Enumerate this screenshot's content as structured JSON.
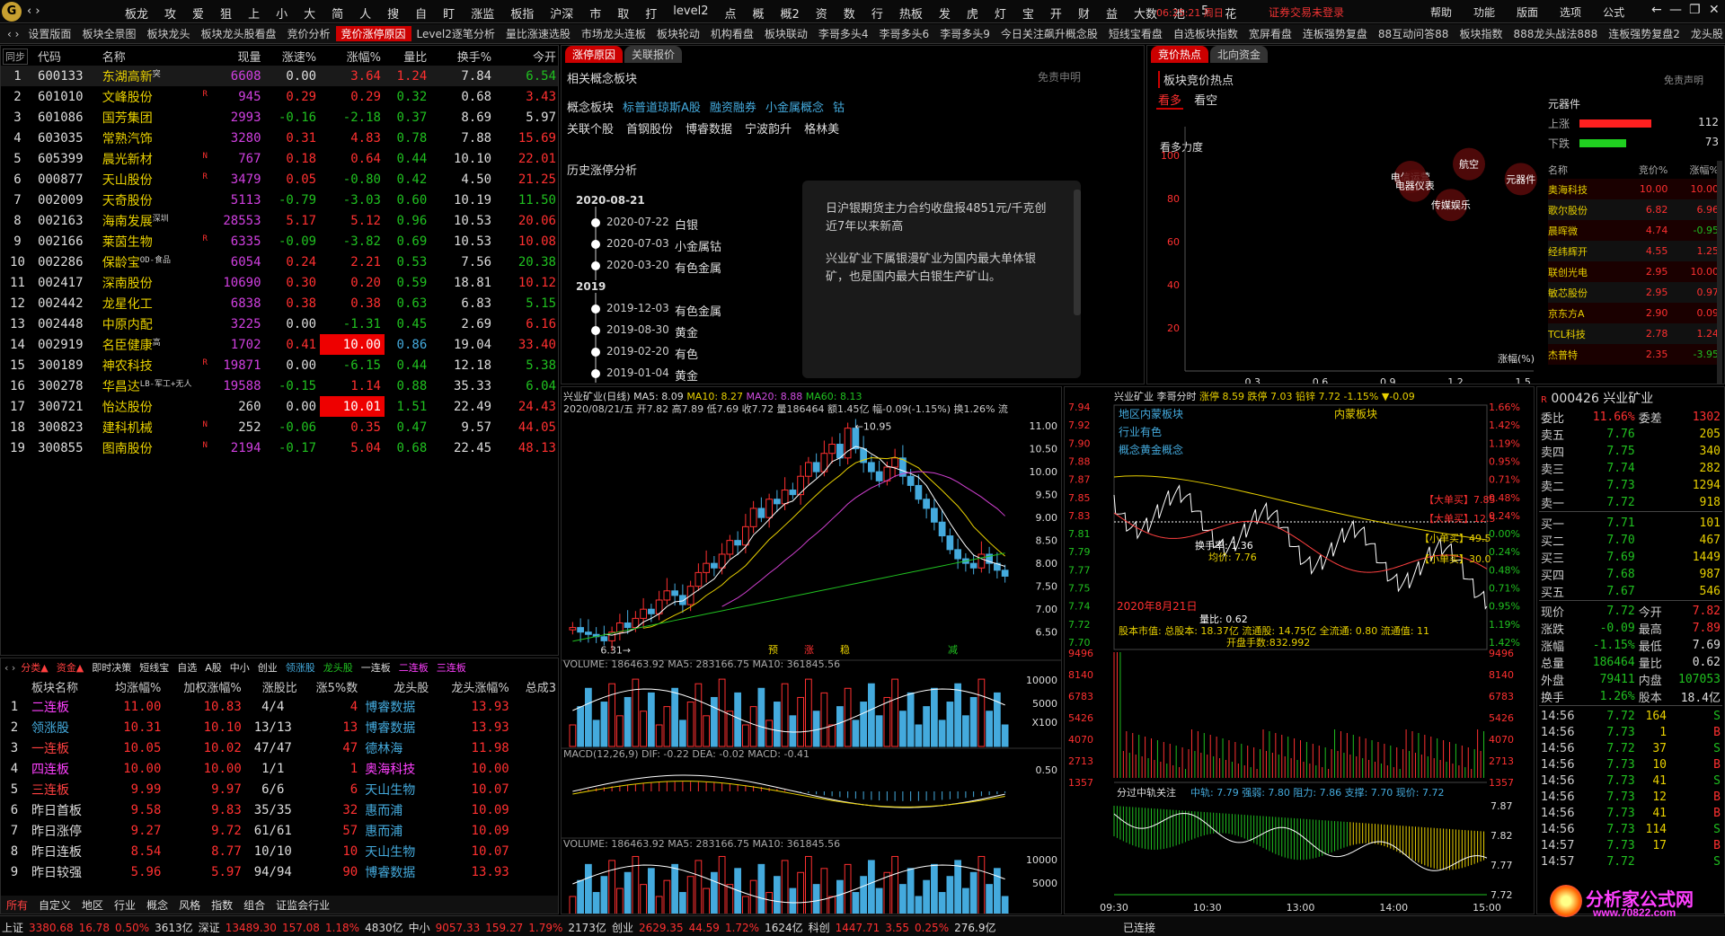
{
  "topbar": {
    "menu": [
      "板龙",
      "攻",
      "爱",
      "狙",
      "上",
      "小",
      "大",
      "简",
      "人",
      "搜",
      "自",
      "盯",
      "涨监",
      "板指",
      "沪深",
      "市",
      "取",
      "打",
      "level2",
      "点",
      "概",
      "概2",
      "资",
      "数",
      "行",
      "热板",
      "发",
      "虎",
      "灯",
      "宝",
      "开",
      "财",
      "益",
      "大数",
      "池",
      "5",
      "花"
    ],
    "clock": "06:25:21 周日",
    "status": "证券交易未登录",
    "right": [
      "帮助",
      "功能",
      "版面",
      "选项",
      "公式"
    ]
  },
  "tabs": [
    "设置版面",
    "板块全景图",
    "板块龙头",
    "板块龙头股看盘",
    "竞价分析",
    "竞价涨停原因",
    "Level2逐笔分析",
    "量比涨速选股",
    "市场龙头连板",
    "板块轮动",
    "机构看盘",
    "板块联动",
    "李哥多头4",
    "李哥多头6",
    "李哥多头9",
    "今日关注飙升概念股",
    "短线宝看盘",
    "自选板块指数",
    "宽屏看盘",
    "连板强势复盘",
    "88互动问答88",
    "板块指数",
    "888龙头战法888",
    "连板强势复盘2",
    "龙头股"
  ],
  "active_tab": "竞价涨停原因",
  "stock_list": {
    "headers": [
      "代码",
      "名称",
      "",
      "现量",
      "涨速%",
      "涨幅%",
      "量比",
      "换手%",
      "今开"
    ],
    "rows": [
      {
        "n": "1",
        "code": "600133",
        "name": "东湖高新",
        "tag": "突",
        "mark": "",
        "vol": "6608",
        "spd": "0.00",
        "chg": "3.64",
        "lb": "1.24",
        "hs": "7.84",
        "open": "6.54",
        "vc": "mag",
        "sc": "wht",
        "cc": "red",
        "oc": "grn",
        "lc": "red"
      },
      {
        "n": "2",
        "code": "601010",
        "name": "文峰股份",
        "tag": "",
        "mark": "R",
        "vol": "945",
        "spd": "0.29",
        "chg": "0.29",
        "lb": "0.32",
        "hs": "0.68",
        "open": "3.43",
        "vc": "mag",
        "sc": "red",
        "cc": "red",
        "oc": "red",
        "lc": "grn"
      },
      {
        "n": "3",
        "code": "601086",
        "name": "国芳集团",
        "tag": "",
        "mark": "",
        "vol": "2993",
        "spd": "-0.16",
        "chg": "-2.18",
        "lb": "0.37",
        "hs": "8.69",
        "open": "5.97",
        "vc": "mag",
        "sc": "grn",
        "cc": "grn",
        "oc": "wht",
        "lc": "grn"
      },
      {
        "n": "4",
        "code": "603035",
        "name": "常熟汽饰",
        "tag": "",
        "mark": "",
        "vol": "3280",
        "spd": "0.31",
        "chg": "4.83",
        "lb": "0.78",
        "hs": "7.88",
        "open": "15.69",
        "vc": "mag",
        "sc": "red",
        "cc": "red",
        "oc": "red",
        "lc": "grn"
      },
      {
        "n": "5",
        "code": "605399",
        "name": "晨光新材",
        "tag": "",
        "mark": "N",
        "vol": "767",
        "spd": "0.18",
        "chg": "0.64",
        "lb": "0.44",
        "hs": "10.10",
        "open": "22.01",
        "vc": "mag",
        "sc": "red",
        "cc": "red",
        "oc": "red",
        "lc": "grn"
      },
      {
        "n": "6",
        "code": "000877",
        "name": "天山股份",
        "tag": "",
        "mark": "R",
        "vol": "3479",
        "spd": "0.05",
        "chg": "-0.80",
        "lb": "0.42",
        "hs": "4.50",
        "open": "21.25",
        "vc": "mag",
        "sc": "red",
        "cc": "grn",
        "oc": "red",
        "lc": "grn"
      },
      {
        "n": "7",
        "code": "002009",
        "name": "天奇股份",
        "tag": "",
        "mark": "",
        "vol": "5113",
        "spd": "-0.79",
        "chg": "-3.03",
        "lb": "0.60",
        "hs": "10.19",
        "open": "11.50",
        "vc": "mag",
        "sc": "grn",
        "cc": "grn",
        "oc": "grn",
        "lc": "grn"
      },
      {
        "n": "8",
        "code": "002163",
        "name": "海南发展",
        "tag": "深圳",
        "mark": "",
        "vol": "28553",
        "spd": "5.17",
        "chg": "5.12",
        "lb": "0.96",
        "hs": "10.53",
        "open": "20.06",
        "vc": "mag",
        "sc": "red",
        "cc": "red",
        "oc": "red",
        "lc": "grn"
      },
      {
        "n": "9",
        "code": "002166",
        "name": "莱茵生物",
        "tag": "",
        "mark": "R",
        "vol": "6335",
        "spd": "-0.09",
        "chg": "-3.82",
        "lb": "0.69",
        "hs": "10.53",
        "open": "10.08",
        "vc": "mag",
        "sc": "grn",
        "cc": "grn",
        "oc": "red",
        "lc": "grn"
      },
      {
        "n": "10",
        "code": "002286",
        "name": "保龄宝",
        "tag": "OD-食品",
        "mark": "",
        "vol": "6054",
        "spd": "0.24",
        "chg": "2.21",
        "lb": "0.53",
        "hs": "7.56",
        "open": "20.38",
        "vc": "mag",
        "sc": "red",
        "cc": "red",
        "oc": "grn",
        "lc": "grn"
      },
      {
        "n": "11",
        "code": "002417",
        "name": "深南股份",
        "tag": "",
        "mark": "",
        "vol": "10690",
        "spd": "0.30",
        "chg": "0.20",
        "lb": "0.59",
        "hs": "18.81",
        "open": "10.12",
        "vc": "mag",
        "sc": "red",
        "cc": "red",
        "oc": "red",
        "lc": "grn"
      },
      {
        "n": "12",
        "code": "002442",
        "name": "龙星化工",
        "tag": "",
        "mark": "",
        "vol": "6838",
        "spd": "0.38",
        "chg": "0.38",
        "lb": "0.63",
        "hs": "6.83",
        "open": "5.15",
        "vc": "mag",
        "sc": "red",
        "cc": "red",
        "oc": "grn",
        "lc": "grn"
      },
      {
        "n": "13",
        "code": "002448",
        "name": "中原内配",
        "tag": "",
        "mark": "",
        "vol": "3225",
        "spd": "0.00",
        "chg": "-1.31",
        "lb": "0.45",
        "hs": "2.69",
        "open": "6.16",
        "vc": "mag",
        "sc": "wht",
        "cc": "grn",
        "oc": "red",
        "lc": "grn"
      },
      {
        "n": "14",
        "code": "002919",
        "name": "名臣健康",
        "tag": "高",
        "mark": "",
        "vol": "1702",
        "spd": "0.41",
        "chg": "10.00",
        "lb": "0.86",
        "hs": "19.04",
        "open": "33.40",
        "vc": "mag",
        "sc": "red",
        "cc": "hl",
        "oc": "red",
        "lc": "cyan"
      },
      {
        "n": "15",
        "code": "300189",
        "name": "神农科技",
        "tag": "",
        "mark": "R",
        "vol": "19871",
        "spd": "0.00",
        "chg": "-6.15",
        "lb": "0.44",
        "hs": "12.18",
        "open": "5.38",
        "vc": "mag",
        "sc": "wht",
        "cc": "grn",
        "oc": "grn",
        "lc": "grn"
      },
      {
        "n": "16",
        "code": "300278",
        "name": "华昌达",
        "tag": "LB-军工+无人",
        "mark": "",
        "vol": "19588",
        "spd": "-0.15",
        "chg": "1.14",
        "lb": "0.88",
        "hs": "35.33",
        "open": "6.04",
        "vc": "mag",
        "sc": "grn",
        "cc": "red",
        "oc": "grn",
        "lc": "grn"
      },
      {
        "n": "17",
        "code": "300721",
        "name": "怡达股份",
        "tag": "",
        "mark": "",
        "vol": "260",
        "spd": "0.00",
        "chg": "10.01",
        "lb": "1.51",
        "hs": "22.49",
        "open": "24.43",
        "vc": "wht",
        "sc": "wht",
        "cc": "hl",
        "oc": "red",
        "lc": "grn"
      },
      {
        "n": "18",
        "code": "300823",
        "name": "建科机械",
        "tag": "",
        "mark": "N",
        "vol": "252",
        "spd": "-0.06",
        "chg": "0.35",
        "lb": "0.47",
        "hs": "9.57",
        "open": "44.05",
        "vc": "wht",
        "sc": "grn",
        "cc": "red",
        "oc": "red",
        "lc": "grn"
      },
      {
        "n": "19",
        "code": "300855",
        "name": "图南股份",
        "tag": "",
        "mark": "N",
        "vol": "2194",
        "spd": "-0.17",
        "chg": "5.04",
        "lb": "0.68",
        "hs": "22.45",
        "open": "48.13",
        "vc": "mag",
        "sc": "grn",
        "cc": "red",
        "oc": "red",
        "lc": "grn"
      }
    ]
  },
  "concept": {
    "tabs": [
      "涨停原因",
      "关联报价"
    ],
    "title": "相关概念板块",
    "disclaimer": "免责申明",
    "label1": "概念板块",
    "items1": [
      "标普道琼斯A股",
      "融资融券",
      "小金属概念",
      "钴"
    ],
    "label2": "关联个股",
    "items2": [
      "首钢股份",
      "博睿数据",
      "宁波韵升",
      "格林美"
    ],
    "history_title": "历史涨停分析",
    "timeline": [
      {
        "year": "2020-08-21",
        "entries": [
          [
            "2020-07-22",
            "白银"
          ],
          [
            "2020-07-03",
            "小金属钴"
          ],
          [
            "2020-03-20",
            "有色金属"
          ]
        ]
      },
      {
        "year": "2019",
        "entries": [
          [
            "2019-12-03",
            "有色金属"
          ],
          [
            "2019-08-30",
            "黄金"
          ],
          [
            "2019-02-20",
            "有色"
          ],
          [
            "2019-01-04",
            "黄金"
          ]
        ]
      }
    ],
    "popup": [
      "日沪银期货主力合约收盘报4851元/千克创近7年以来新高",
      "兴业矿业下属银漫矿业为国内最大单体银矿，也是国内最大白银生产矿山。"
    ]
  },
  "hot": {
    "tabs": [
      "竞价热点",
      "北向资金"
    ],
    "title": "板块竞价热点",
    "disclaimer": "免责声明",
    "bull": "看多",
    "bear": "看空",
    "ylabel": "看多力度",
    "xlabel": "涨幅(%)",
    "yticks": [
      "100",
      "80",
      "60",
      "40",
      "20"
    ],
    "xticks": [
      "0.3",
      "0.6",
      "0.9",
      "1.2",
      "1.5"
    ],
    "bubbles": [
      {
        "label": "航空",
        "x": 1.26,
        "y": 96
      },
      {
        "label": "电信运营",
        "x": 1.0,
        "y": 90
      },
      {
        "label": "电器仪表",
        "x": 1.02,
        "y": 86
      },
      {
        "label": "元器件",
        "x": 1.49,
        "y": 89
      },
      {
        "label": "传媒娱乐",
        "x": 1.18,
        "y": 77
      }
    ]
  },
  "sector": {
    "name": "元器件",
    "up_label": "上涨",
    "up": "112",
    "down_label": "下跌",
    "down": "73",
    "headers": [
      "名称",
      "竞价%",
      "涨幅%"
    ],
    "rows": [
      [
        "奥海科技",
        "10.00",
        "10.00"
      ],
      [
        "歌尔股份",
        "6.82",
        "6.96"
      ],
      [
        "晨晖微",
        "4.74",
        "-0.95"
      ],
      [
        "经纬辉开",
        "4.55",
        "1.25"
      ],
      [
        "联创光电",
        "2.95",
        "10.00"
      ],
      [
        "敏芯股份",
        "2.95",
        "0.97"
      ],
      [
        "京东方A",
        "2.90",
        "0.09"
      ],
      [
        "TCL科技",
        "2.78",
        "1.24"
      ],
      [
        "杰普特",
        "2.35",
        "-3.95"
      ]
    ]
  },
  "kline": {
    "title": "兴业矿业(日线)",
    "ma": [
      "MA5: 8.09",
      "MA10: 8.27",
      "MA20: 8.88",
      "MA60: 8.13"
    ],
    "info": "2020/08/21/五 开7.82 高7.89 低7.69 收7.72 量186464 额1.45亿 幅-0.09(-1.15%) 换1.26% 流",
    "high_label": "10.95",
    "low_label": "6.31",
    "yticks": [
      "11.00",
      "10.50",
      "10.00",
      "9.50",
      "9.00",
      "8.50",
      "8.00",
      "7.50",
      "7.00",
      "6.50"
    ],
    "markers": [
      "预",
      "涨",
      "稳",
      "减"
    ],
    "vol_info": "VOLUME: 186463.92 MA5: 283166.75 MA10: 361845.56",
    "vol_ticks": [
      "10000",
      "5000",
      "X100"
    ],
    "macd_info": "MACD(12,26,9) DIF: -0.22 DEA: -0.02 MACD: -0.41",
    "macd_tick": "0.50",
    "vol2_info": "VOLUME: 186463.92 MA5: 283166.75 MA10: 361845.56",
    "vol2_ticks": [
      "10000",
      "5000"
    ]
  },
  "intraday": {
    "title": "兴业矿业",
    "sub": "李哥分时",
    "info": "涨停 8.59 跌停 7.03 铅锌 7.72 -1.15% ▼-0.09",
    "tags": [
      "地区内蒙板块",
      "行业有色",
      "概念黄金概念"
    ],
    "ann": "内蒙板块",
    "buy1": "【大单买】7.85",
    "buy2": "【大单买】12.5",
    "buy3": "【小单买】49.5",
    "buy4": "【小单买】30.0",
    "hs": "换手率: 1.36",
    "avg": "均价: 7.76",
    "date": "2020年8月21日",
    "mkt": "股本市值: 总股本: 18.37亿 流通股: 14.75亿 全流通: 0.80 流通值: 11",
    "open_amt": "开盘手数:832.992",
    "lb": "量比: 0.62",
    "left_ticks": [
      "7.94",
      "7.92",
      "7.90",
      "7.88",
      "7.87",
      "7.85",
      "7.83",
      "7.81",
      "7.79",
      "7.77",
      "7.75",
      "7.74",
      "7.72",
      "7.70"
    ],
    "right_ticks": [
      "1.66%",
      "1.42%",
      "1.19%",
      "0.95%",
      "0.71%",
      "0.48%",
      "0.24%",
      "0.00%",
      "0.24%",
      "0.48%",
      "0.71%",
      "0.95%",
      "1.19%",
      "1.42%"
    ],
    "vol_ticks": [
      "9496",
      "8140",
      "6783",
      "5426",
      "4070",
      "2713",
      "1357"
    ],
    "sub_title": "分过中轨关注",
    "sub_info": "中轨: 7.79 强弱: 7.80 阻力: 7.86 支撑: 7.70 现价: 7.72",
    "sub_ticks": [
      "7.87",
      "7.82",
      "7.77",
      "7.72"
    ],
    "times": [
      "09:30",
      "10:30",
      "13:00",
      "14:00",
      "15:00"
    ]
  },
  "quote": {
    "code": "000426",
    "name": "兴业矿业",
    "wb_label": "委比",
    "wb": "11.66%",
    "wc_label": "委差",
    "wc": "1302",
    "sell": [
      [
        "卖五",
        "7.76",
        "205"
      ],
      [
        "卖四",
        "7.75",
        "340"
      ],
      [
        "卖三",
        "7.74",
        "282"
      ],
      [
        "卖二",
        "7.73",
        "1294"
      ],
      [
        "卖一",
        "7.72",
        "918"
      ]
    ],
    "buy": [
      [
        "买一",
        "7.71",
        "101"
      ],
      [
        "买二",
        "7.70",
        "467"
      ],
      [
        "买三",
        "7.69",
        "1449"
      ],
      [
        "买四",
        "7.68",
        "987"
      ],
      [
        "买五",
        "7.67",
        "546"
      ]
    ],
    "stats": [
      [
        "现价",
        "7.72",
        "今开",
        "7.82"
      ],
      [
        "涨跌",
        "-0.09",
        "最高",
        "7.89"
      ],
      [
        "涨幅",
        "-1.15%",
        "最低",
        "7.69"
      ],
      [
        "总量",
        "186464",
        "量比",
        "0.62"
      ],
      [
        "外盘",
        "79411",
        "内盘",
        "107053"
      ],
      [
        "换手",
        "1.26%",
        "股本",
        "18.4亿"
      ]
    ],
    "ticks": [
      [
        "14:56",
        "7.72",
        "164",
        "S"
      ],
      [
        "14:56",
        "7.73",
        "1",
        "B"
      ],
      [
        "14:56",
        "7.72",
        "37",
        "S"
      ],
      [
        "14:56",
        "7.73",
        "10",
        "B"
      ],
      [
        "14:56",
        "7.73",
        "41",
        "S"
      ],
      [
        "14:56",
        "7.73",
        "12",
        "B"
      ],
      [
        "14:56",
        "7.73",
        "41",
        "B"
      ],
      [
        "14:56",
        "7.73",
        "114",
        "S"
      ],
      [
        "14:57",
        "7.73",
        "17",
        "B"
      ],
      [
        "14:57",
        "7.72",
        "",
        "S"
      ]
    ]
  },
  "board": {
    "tabs": [
      "分类▲",
      "资金▲",
      "即时决策",
      "短线宝",
      "自选",
      "A股",
      "中小",
      "创业",
      "领涨股",
      "龙头股",
      "一连板",
      "二连板",
      "三连板"
    ],
    "headers": [
      "板块名称",
      "均涨幅%",
      "加权涨幅%",
      "涨股比",
      "涨5%数",
      "龙头股",
      "龙头涨幅%",
      "总成3"
    ],
    "rows": [
      [
        "1",
        "二连板",
        "11.00",
        "10.83",
        "4/4",
        "4",
        "博睿数据",
        "13.93"
      ],
      [
        "2",
        "领涨股",
        "10.31",
        "10.10",
        "13/13",
        "13",
        "博睿数据",
        "13.93"
      ],
      [
        "3",
        "一连板",
        "10.05",
        "10.02",
        "47/47",
        "47",
        "德林海",
        "11.98"
      ],
      [
        "4",
        "四连板",
        "10.00",
        "10.00",
        "1/1",
        "1",
        "奥海科技",
        "10.00"
      ],
      [
        "5",
        "三连板",
        "9.99",
        "9.97",
        "6/6",
        "6",
        "天山生物",
        "10.07"
      ],
      [
        "6",
        "昨日首板",
        "9.58",
        "9.83",
        "35/35",
        "32",
        "惠而浦",
        "10.09"
      ],
      [
        "7",
        "昨日涨停",
        "9.27",
        "9.72",
        "61/61",
        "57",
        "惠而浦",
        "10.09"
      ],
      [
        "8",
        "昨日连板",
        "8.54",
        "8.77",
        "10/10",
        "10",
        "天山生物",
        "10.07"
      ],
      [
        "9",
        "昨日较强",
        "5.96",
        "5.97",
        "94/94",
        "90",
        "博睿数据",
        "13.93"
      ]
    ],
    "bottom_tabs": [
      "所有",
      "自定义",
      "地区",
      "行业",
      "概念",
      "风格",
      "指数",
      "组合",
      "证监会行业"
    ]
  },
  "status": {
    "items": [
      [
        "上证",
        "3380.68",
        "16.78",
        "0.50%",
        "3613亿"
      ],
      [
        "深证",
        "13489.30",
        "157.08",
        "1.18%",
        "4830亿"
      ],
      [
        "中小",
        "9057.33",
        "159.27",
        "1.79%",
        "2173亿"
      ],
      [
        "创业",
        "2629.35",
        "44.59",
        "1.72%",
        "1624亿"
      ],
      [
        "科创",
        "1447.71",
        "3.55",
        "0.25%",
        "276.9亿"
      ]
    ],
    "conn": "已连接"
  },
  "watermark": {
    "brand": "分析家公式网",
    "url": "www.70822.com"
  },
  "colors": {
    "up": "#ff3030",
    "down": "#20c020",
    "accent": "#c00000",
    "ma5": "#ffffff",
    "ma10": "#e8d000",
    "ma20": "#d040d0",
    "ma60": "#20c020",
    "cyan": "#4ad"
  }
}
